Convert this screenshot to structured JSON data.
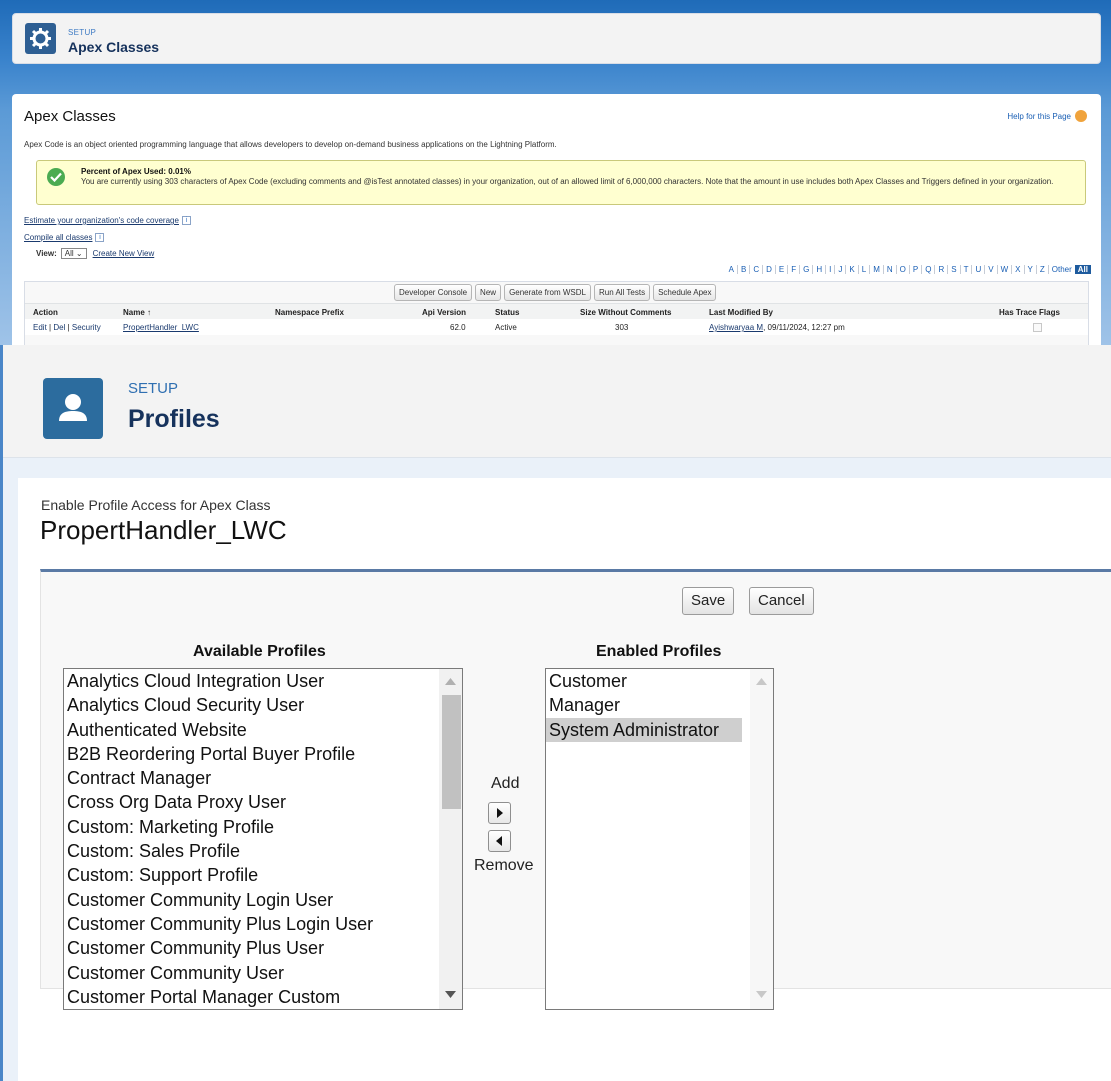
{
  "apex": {
    "header": {
      "kicker": "SETUP",
      "title": "Apex Classes"
    },
    "page_title": "Apex Classes",
    "help_link": "Help for this Page",
    "description": "Apex Code is an object oriented programming language that allows developers to develop on-demand business applications on the Lightning Platform.",
    "usage": {
      "heading": "Percent of Apex Used: 0.01%",
      "text": "You are currently using 303 characters of Apex Code (excluding comments and @isTest annotated classes) in your organization, out of an allowed limit of 6,000,000 characters. Note that the amount in use includes both Apex Classes and Triggers defined in your organization."
    },
    "links": {
      "coverage": "Estimate your organization's code coverage",
      "compile": "Compile all classes"
    },
    "view": {
      "label": "View:",
      "selected": "All",
      "create_link": "Create New View"
    },
    "alphabet": [
      "A",
      "B",
      "C",
      "D",
      "E",
      "F",
      "G",
      "H",
      "I",
      "J",
      "K",
      "L",
      "M",
      "N",
      "O",
      "P",
      "Q",
      "R",
      "S",
      "T",
      "U",
      "V",
      "W",
      "X",
      "Y",
      "Z",
      "Other",
      "All"
    ],
    "toolbar": [
      "Developer Console",
      "New",
      "Generate from WSDL",
      "Run All Tests",
      "Schedule Apex"
    ],
    "columns": {
      "action": "Action",
      "name": "Name ↑",
      "namespace": "Namespace Prefix",
      "api": "Api Version",
      "status": "Status",
      "size": "Size Without Comments",
      "modified": "Last Modified By",
      "trace": "Has Trace Flags"
    },
    "row": {
      "edit": "Edit",
      "del": "Del",
      "security": "Security",
      "name": "PropertHandler_LWC",
      "namespace": "",
      "api": "62.0",
      "status": "Active",
      "size": "303",
      "modified_by": "Ayishwaryaa M",
      "modified_date": ", 09/11/2024, 12:27 pm"
    }
  },
  "profiles": {
    "header": {
      "kicker": "SETUP",
      "title": "Profiles"
    },
    "subtitle": "Enable Profile Access for Apex Class",
    "class_name": "PropertHandler_LWC",
    "save_label": "Save",
    "cancel_label": "Cancel",
    "available_heading": "Available Profiles",
    "enabled_heading": "Enabled Profiles",
    "add_label": "Add",
    "remove_label": "Remove",
    "available": [
      "Analytics Cloud Integration User",
      "Analytics Cloud Security User",
      "Authenticated Website",
      "B2B Reordering Portal Buyer Profile",
      "Contract Manager",
      "Cross Org Data Proxy User",
      "Custom: Marketing Profile",
      "Custom: Sales Profile",
      "Custom: Support Profile",
      "Customer Community Login User",
      "Customer Community Plus Login User",
      "Customer Community Plus User",
      "Customer Community User",
      "Customer Portal Manager Custom"
    ],
    "enabled": [
      "Customer",
      "Manager",
      "System Administrator"
    ],
    "enabled_selected": "System Administrator"
  },
  "colors": {
    "brand_blue": "#2c6c9e",
    "header_gradient_top": "#1f6bb8",
    "warn_bg": "#ffffd0",
    "success_green": "#4bab52"
  }
}
